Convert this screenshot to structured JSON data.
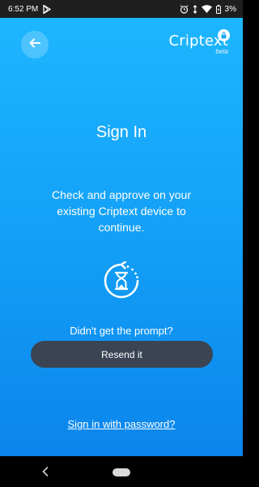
{
  "status_bar": {
    "time": "6:52 PM",
    "battery": "3%",
    "icons": [
      "play-store-icon",
      "alarm-icon",
      "data-arrows-icon",
      "wifi-icon",
      "battery-icon"
    ]
  },
  "header": {
    "logo_text": "Criptext",
    "logo_badge": "lock-icon",
    "beta_label": "beta",
    "back_icon": "arrow-left-icon"
  },
  "main": {
    "title": "Sign In",
    "instructions": "Check and approve on your existing Criptext device to continue.",
    "waiting_icon": "hourglass-icon",
    "prompt_question": "Didn't get the prompt?",
    "resend_label": "Resend it",
    "password_link": "Sign in with password?"
  },
  "nav_bar": {
    "icons": [
      "nav-back-icon",
      "nav-home-pill"
    ]
  },
  "colors": {
    "gradient_top": "#1eb6ff",
    "gradient_bottom": "#0b85ec",
    "button_dark": "#3a4452",
    "status_bar": "#1f1f1f"
  }
}
